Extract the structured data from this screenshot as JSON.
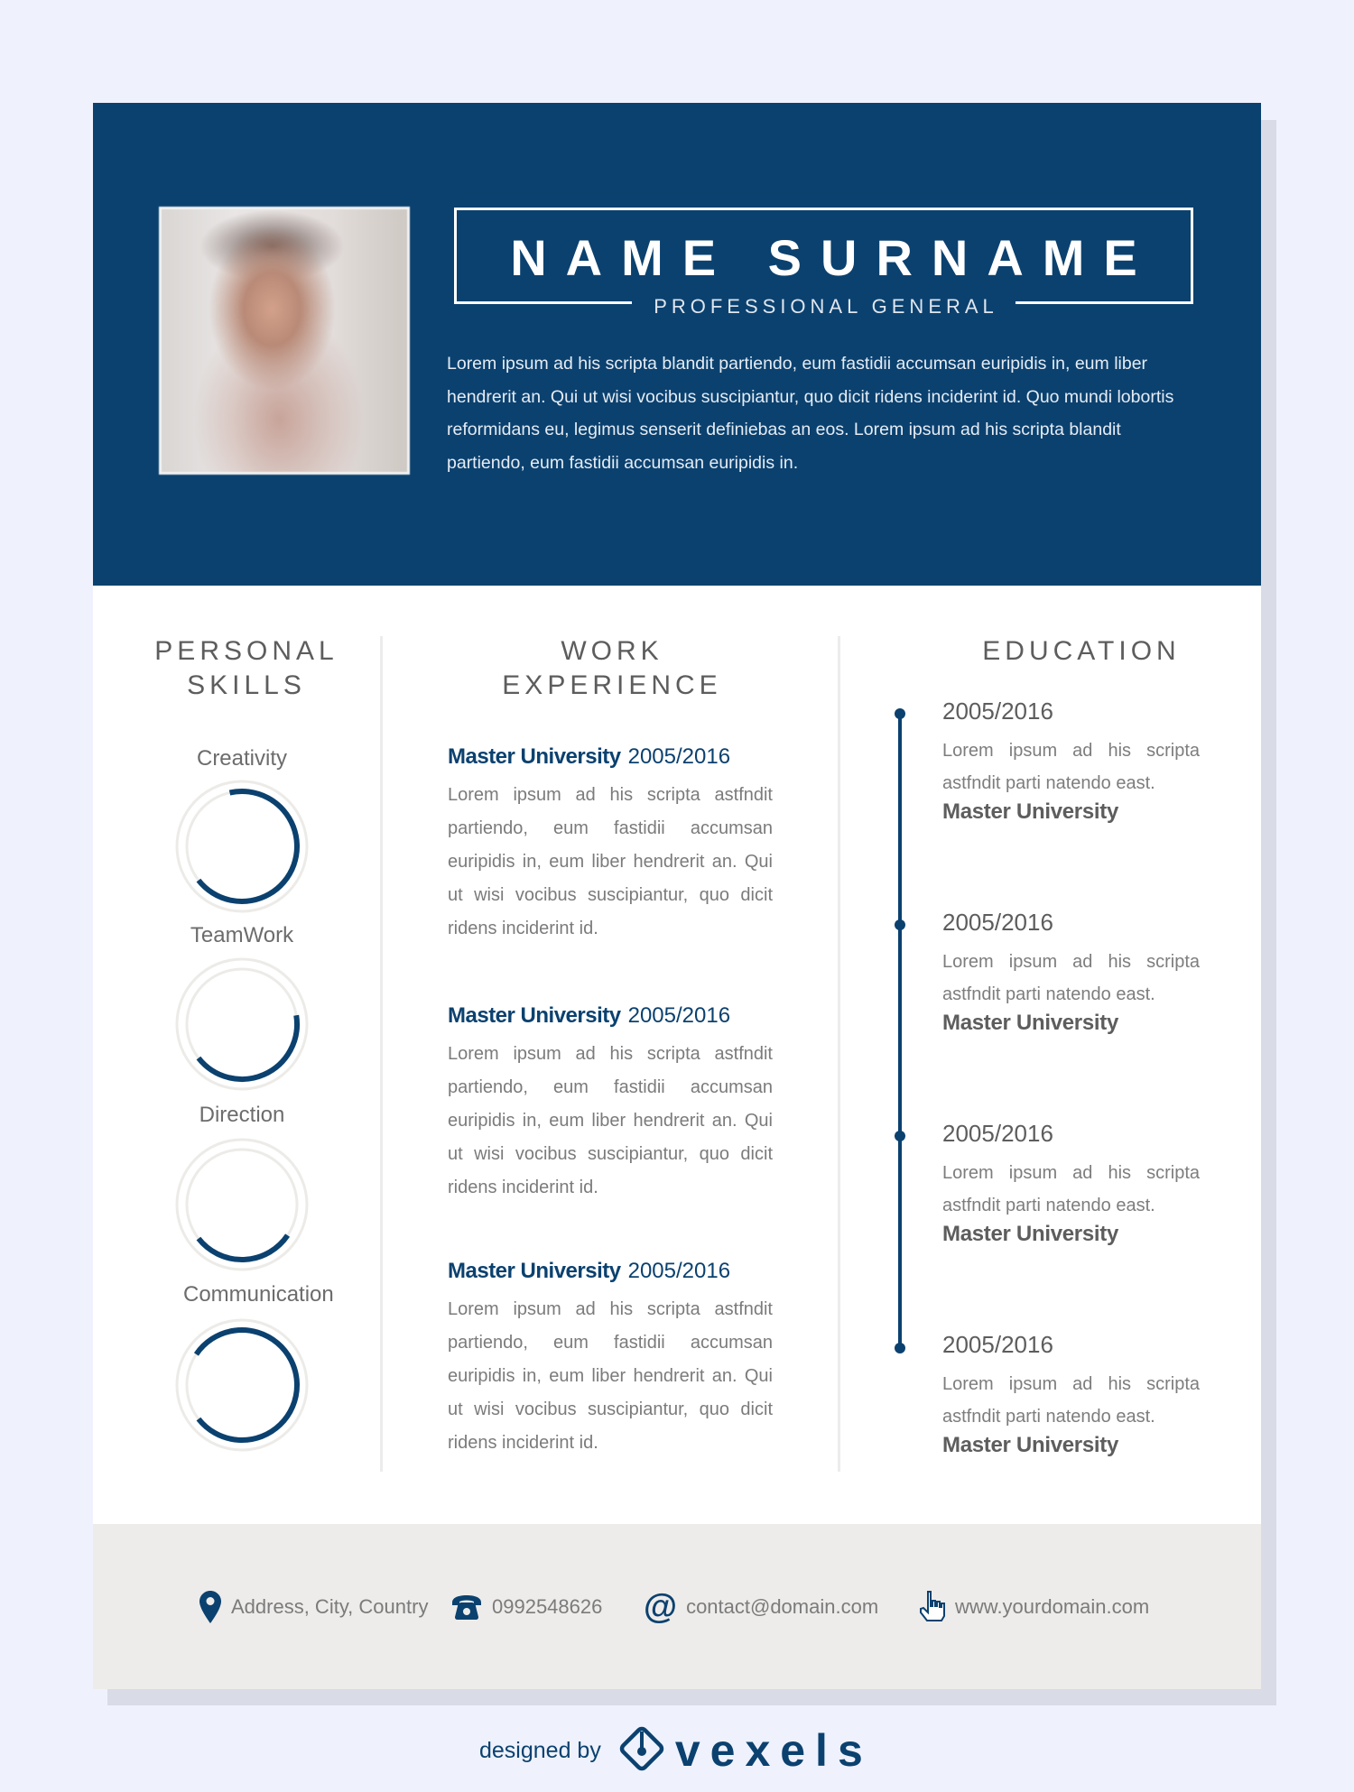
{
  "header": {
    "name": "NAME SURNAME",
    "subtitle": "PROFESSIONAL GENERAL",
    "photo_alt": "profile-photo (blurred)",
    "summary": "Lorem ipsum ad his scripta blandit partiendo, eum fastidii accumsan euripidis in, eum liber hendrerit an. Qui ut wisi vocibus suscipiantur, quo dicit ridens inciderint id. Quo mundi lobortis reformidans eu, legimus senserit definiebas an eos. Lorem ipsum ad his scripta blandit partiendo, eum fastidii accumsan euripidis in."
  },
  "skills": {
    "title_line1": "PERSONAL",
    "title_line2": "SKILLS",
    "items": [
      {
        "label": "Creativity",
        "level": 0.68
      },
      {
        "label": "TeamWork",
        "level": 0.42
      },
      {
        "label": "Direction",
        "level": 0.3
      },
      {
        "label": "Communication",
        "level": 0.8
      }
    ]
  },
  "work": {
    "title_line1": "WORK",
    "title_line2": "EXPERIENCE",
    "items": [
      {
        "title": "Master University",
        "date": "2005/2016",
        "description": "Lorem ipsum ad his scripta astfndit partiendo, eum fastidii accumsan euripidis in, eum liber hendrerit an. Qui ut wisi vocibus suscipiantur, quo dicit ridens inciderint id."
      },
      {
        "title": "Master University",
        "date": "2005/2016",
        "description": "Lorem ipsum ad his scripta astfndit partiendo, eum fastidii accumsan euripidis in, eum liber hendrerit an. Qui ut wisi vocibus suscipiantur, quo dicit ridens inciderint id."
      },
      {
        "title": "Master University",
        "date": "2005/2016",
        "description": "Lorem ipsum ad his scripta astfndit partiendo, eum fastidii accumsan euripidis in, eum liber hendrerit an. Qui ut wisi vocibus suscipiantur, quo dicit ridens inciderint id."
      }
    ]
  },
  "education": {
    "title": "EDUCATION",
    "items": [
      {
        "date": "2005/2016",
        "description": "Lorem ipsum ad his scripta astfndit parti natendo east.",
        "school": "Master University"
      },
      {
        "date": "2005/2016",
        "description": "Lorem ipsum ad his scripta astfndit parti natendo east.",
        "school": "Master University"
      },
      {
        "date": "2005/2016",
        "description": "Lorem ipsum ad his scripta astfndit parti natendo east.",
        "school": "Master University"
      },
      {
        "date": "2005/2016",
        "description": "Lorem ipsum ad his scripta astfndit parti natendo east.",
        "school": "Master University"
      }
    ]
  },
  "contact": {
    "address": {
      "icon": "map-pin-icon",
      "text": "Address, City, Country"
    },
    "phone": {
      "icon": "telephone-icon",
      "text": "0992548626"
    },
    "email": {
      "icon": "at-sign-icon",
      "text": "contact@domain.com"
    },
    "website": {
      "icon": "pointer-hand-icon",
      "text": "www.yourdomain.com"
    }
  },
  "credit": {
    "prefix": "designed by",
    "brand": "vexels"
  },
  "colors": {
    "primary": "#0b416f",
    "background": "#eff2fd",
    "footer": "#edecea",
    "ring_track": "#ecebe8",
    "heading_text": "#5d5d5d",
    "body_text": "#7b7b7b"
  }
}
